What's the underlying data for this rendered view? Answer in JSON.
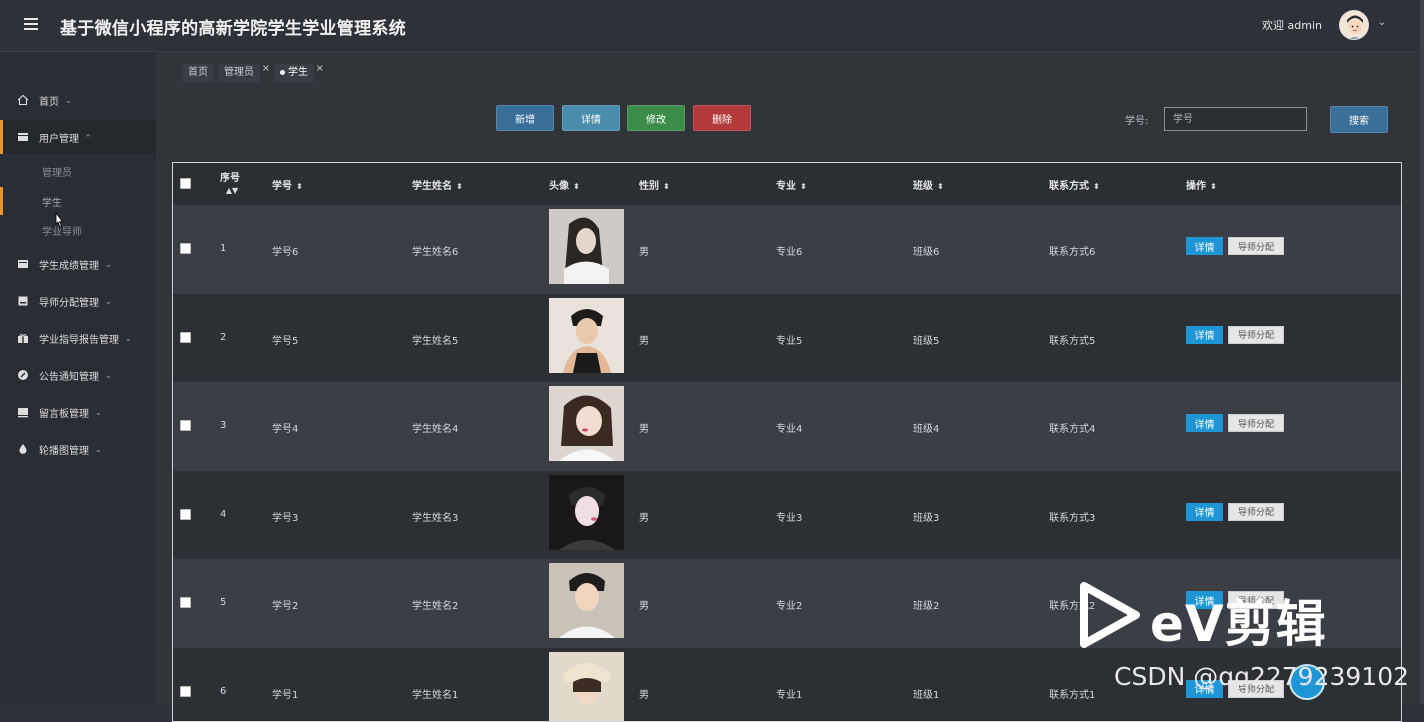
{
  "app": {
    "title": "基于微信小程序的高新学院学生学业管理系统",
    "welcome": "欢迎 admin"
  },
  "sidebar": {
    "items": [
      {
        "label": "首页",
        "icon": "home-icon"
      },
      {
        "label": "用户管理",
        "icon": "user-manage-icon"
      },
      {
        "label": "学生成绩管理",
        "icon": "grade-icon"
      },
      {
        "label": "导师分配管理",
        "icon": "assign-icon"
      },
      {
        "label": "学业指导报告管理",
        "icon": "gift-icon"
      },
      {
        "label": "公告通知管理",
        "icon": "notice-icon"
      },
      {
        "label": "留言板管理",
        "icon": "message-icon"
      },
      {
        "label": "轮播图管理",
        "icon": "carousel-icon"
      }
    ],
    "sub_items": [
      "管理员",
      "学生",
      "学业导师"
    ]
  },
  "tabs": [
    {
      "label": "首页"
    },
    {
      "label": "管理员",
      "close": "×"
    },
    {
      "label": "学生",
      "close": "×"
    }
  ],
  "toolbar": {
    "add": "新增",
    "detail": "详情",
    "edit": "修改",
    "delete": "删除",
    "search_label": "学号:",
    "search_placeholder": "学号",
    "search_button": "搜索"
  },
  "table": {
    "columns": [
      "序号",
      "学号",
      "学生姓名",
      "头像",
      "性别",
      "专业",
      "班级",
      "联系方式",
      "操作"
    ],
    "op_detail": "详情",
    "op_assign": "导师分配",
    "rows": [
      {
        "idx": "1",
        "sid": "学号6",
        "name": "学生姓名6",
        "gender": "男",
        "major": "专业6",
        "class": "班级6",
        "contact": "联系方式6"
      },
      {
        "idx": "2",
        "sid": "学号5",
        "name": "学生姓名5",
        "gender": "男",
        "major": "专业5",
        "class": "班级5",
        "contact": "联系方式5"
      },
      {
        "idx": "3",
        "sid": "学号4",
        "name": "学生姓名4",
        "gender": "男",
        "major": "专业4",
        "class": "班级4",
        "contact": "联系方式4"
      },
      {
        "idx": "4",
        "sid": "学号3",
        "name": "学生姓名3",
        "gender": "男",
        "major": "专业3",
        "class": "班级3",
        "contact": "联系方式3"
      },
      {
        "idx": "5",
        "sid": "学号2",
        "name": "学生姓名2",
        "gender": "男",
        "major": "专业2",
        "class": "班级2",
        "contact": "联系方式2"
      },
      {
        "idx": "6",
        "sid": "学号1",
        "name": "学生姓名1",
        "gender": "男",
        "major": "专业1",
        "class": "班级1",
        "contact": "联系方式1"
      }
    ]
  },
  "overlay": {
    "watermark": "eV剪辑",
    "csdn": "CSDN @qq2279239102"
  }
}
